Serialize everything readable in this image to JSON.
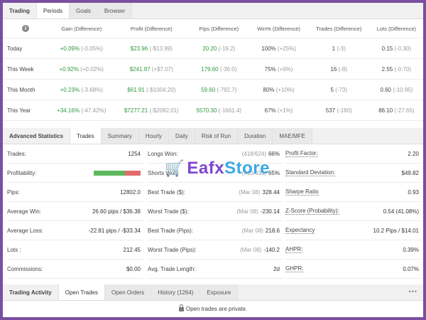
{
  "period_tabs": [
    {
      "label": "Trading"
    },
    {
      "label": "Periods"
    },
    {
      "label": "Goals"
    },
    {
      "label": "Browser"
    }
  ],
  "periods": {
    "headers": [
      "Gain (Difference)",
      "Profit (Difference)",
      "Pips (Difference)",
      "Win% (Difference)",
      "Trades (Difference)",
      "Lots (Difference)"
    ],
    "rows": [
      {
        "label": "Today",
        "gain": "+0.09%",
        "gain_diff": "(-0.05%)",
        "profit": "$23.96",
        "profit_diff": "(-$13.99)",
        "pips": "20.20",
        "pips_diff": "(-19.2)",
        "win": "100%",
        "win_diff": "(+25%)",
        "trades": "1",
        "trades_diff": "(-3)",
        "lots": "0.15",
        "lots_diff": "(-0.30)"
      },
      {
        "label": "This Week",
        "gain": "+0.92%",
        "gain_diff": "(+0.02%)",
        "profit": "$241.87",
        "profit_diff": "(+$7.07)",
        "pips": "179.60",
        "pips_diff": "(-36.0)",
        "win": "75%",
        "win_diff": "(+9%)",
        "trades": "16",
        "trades_diff": "(-8)",
        "lots": "2.55",
        "lots_diff": "(-0.70)"
      },
      {
        "label": "This Month",
        "gain": "+0.23%",
        "gain_diff": "(-3.68%)",
        "profit": "$61.91",
        "profit_diff": "(-$1004.20)",
        "pips": "59.60",
        "pips_diff": "(-792.7)",
        "win": "80%",
        "win_diff": "(+10%)",
        "trades": "5",
        "trades_diff": "(-73)",
        "lots": "0.60",
        "lots_diff": "(-10.95)"
      },
      {
        "label": "This Year",
        "gain": "+34.16%",
        "gain_diff": "(-47.42%)",
        "profit": "$7277.21",
        "profit_diff": "(-$2082.01)",
        "pips": "5570.30",
        "pips_diff": "(-1661.4)",
        "win": "67%",
        "win_diff": "(+1%)",
        "trades": "537",
        "trades_diff": "(-180)",
        "lots": "86.10",
        "lots_diff": "(-27.65)"
      }
    ]
  },
  "advanced_tabs": [
    {
      "label": "Advanced Statistics"
    },
    {
      "label": "Trades"
    },
    {
      "label": "Summary"
    },
    {
      "label": "Hourly"
    },
    {
      "label": "Daily"
    },
    {
      "label": "Risk of Run"
    },
    {
      "label": "Duration"
    },
    {
      "label": "MAE/MFE"
    }
  ],
  "stats_left": [
    {
      "k": "Trades:",
      "v": "1254"
    },
    {
      "k": "Profitability:",
      "v": ""
    },
    {
      "k": "Pips:",
      "v": "12802.0"
    },
    {
      "k": "Average Win:",
      "v": "26.60 pips / $36.38"
    },
    {
      "k": "Average Loss:",
      "v": "-22.81 pips / -$33.34"
    },
    {
      "k": "Lots :",
      "v": "212.45"
    },
    {
      "k": "Commissions:",
      "v": "$0.00"
    }
  ],
  "profitability": {
    "win_fraction": 0.66,
    "win_color": "#5cb85c",
    "loss_color": "#e06c6c"
  },
  "stats_mid": [
    {
      "k": "Longs Won:",
      "g": "(418/624)",
      "v": "66%"
    },
    {
      "k": "Shorts Won:",
      "g": "(410/630)",
      "v": "65%"
    },
    {
      "k": "Best Trade ($):",
      "g": "(Mar 08)",
      "v": "328.44"
    },
    {
      "k": "Worst Trade ($):",
      "g": "(Mar 08)",
      "v": "-230.14"
    },
    {
      "k": "Best Trade (Pips):",
      "g": "(Mar 08)",
      "v": "218.6"
    },
    {
      "k": "Worst Trade (Pips):",
      "g": "(Mar 08)",
      "v": "-140.2"
    },
    {
      "k": "Avg. Trade Length:",
      "g": "",
      "v": "2d"
    }
  ],
  "stats_right": [
    {
      "k": "Profit Factor:",
      "v": "2.20"
    },
    {
      "k": "Standard Deviation:",
      "v": "$49.82"
    },
    {
      "k": "Sharpe Ratio",
      "v": "0.93"
    },
    {
      "k": "Z-Score (Probability):",
      "v": "0.54 (41.08%)"
    },
    {
      "k": "Expectancy",
      "v": "10.2 Pips / $14.01"
    },
    {
      "k": "AHPR:",
      "v": "0.39%"
    },
    {
      "k": "GHPR:",
      "v": "0.07%"
    }
  ],
  "watermark": {
    "part1": "Eafx",
    "part2": "Store"
  },
  "activity_tabs": [
    {
      "label": "Trading Activity"
    },
    {
      "label": "Open Trades"
    },
    {
      "label": "Open Orders"
    },
    {
      "label": "History (1264)"
    },
    {
      "label": "Exposure"
    }
  ],
  "activity": {
    "more": "•••",
    "private_text": "Open trades are private."
  },
  "colors": {
    "accent_frame": "#7a4fa0",
    "positive": "#2e9a3c"
  }
}
